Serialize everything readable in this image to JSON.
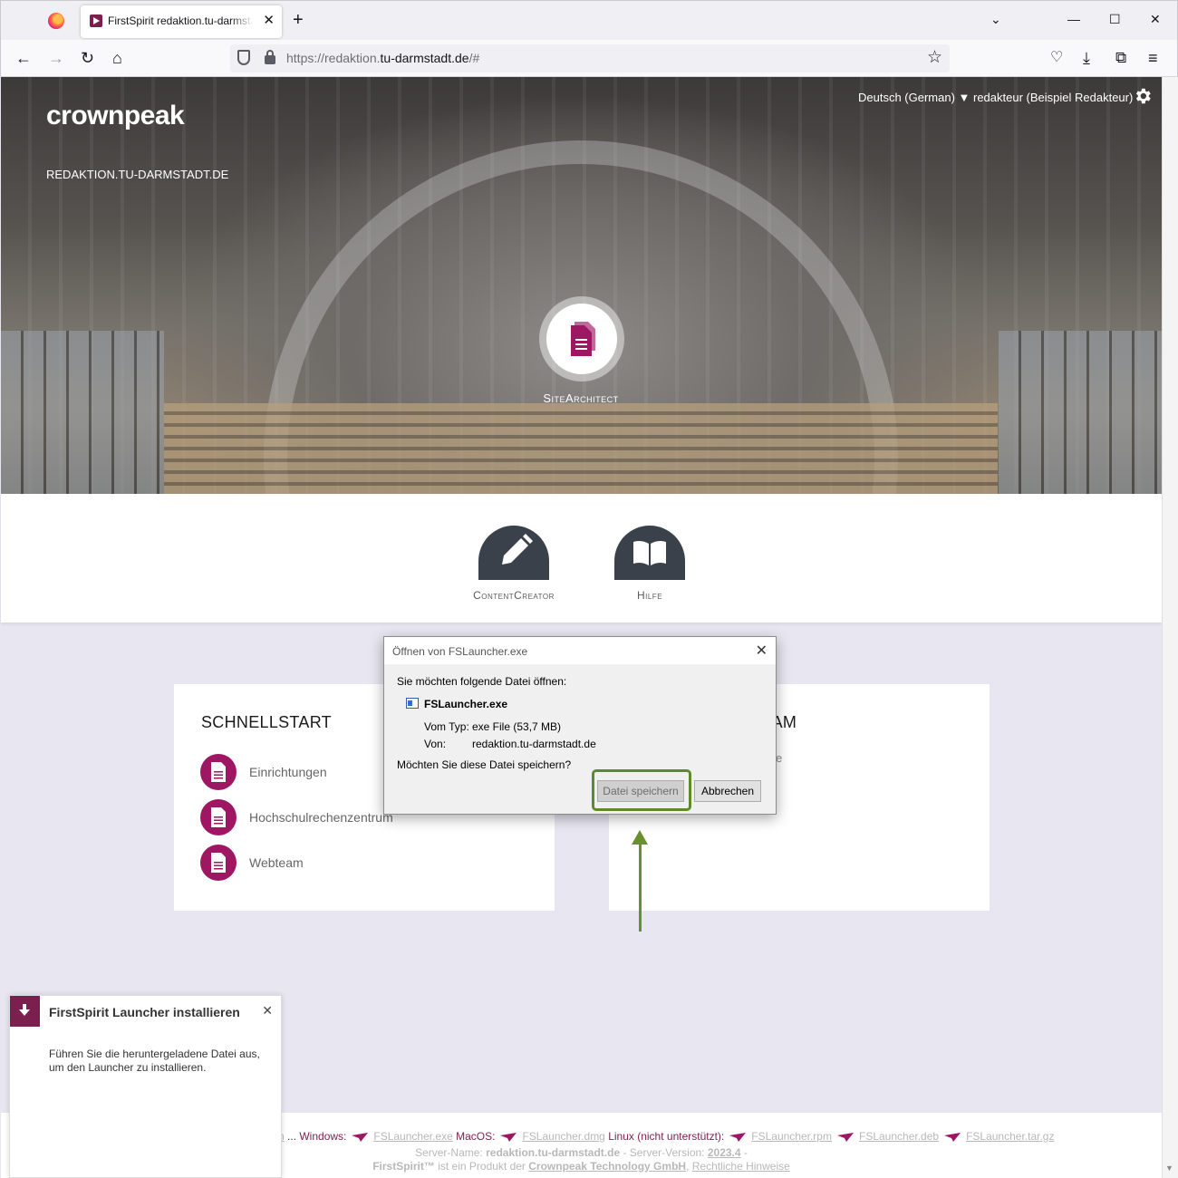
{
  "browser": {
    "tab_title": "FirstSpirit redaktion.tu-darmstadt.de",
    "tab_close": "✕",
    "new_tab": "+",
    "list_tabs": "⌄",
    "minimize": "—",
    "maximize": "☐",
    "close": "✕",
    "url_prefix": "https://redaktion.",
    "url_domain": "tu-darmstadt.de",
    "url_suffix": "/#"
  },
  "header": {
    "logo": "crownpeak",
    "server_name": "REDAKTION.TU-DARMSTADT.DE",
    "language": "Deutsch (German) ▼",
    "user": "redakteur (Beispiel Redakteur)"
  },
  "apps": {
    "site_architect": "SiteArchitect",
    "content_creator": "ContentCreator",
    "help": "Hilfe"
  },
  "quickstart": {
    "title": "SCHNELLSTART",
    "items": [
      {
        "label": "Einrichtungen"
      },
      {
        "label": "Hochschulrechenzentrum"
      },
      {
        "label": "Webteam"
      }
    ]
  },
  "right_card": {
    "title_visible": "TEAM",
    "text_visible": "e"
  },
  "dialog": {
    "title": "Öffnen von FSLauncher.exe",
    "close": "✕",
    "prompt": "Sie möchten folgende Datei öffnen:",
    "filename": "FSLauncher.exe",
    "type_label": "Vom Typ:",
    "type_value": "exe File (53,7 MB)",
    "from_label": "Von:",
    "from_value": "redaktion.tu-darmstadt.de",
    "question": "Möchten Sie diese Datei speichern?",
    "save_button": "Datei speichern",
    "cancel_button": "Abbrechen"
  },
  "footer": {
    "line1_lead": "n",
    "line1_dots": " ... ",
    "windows_label": "Windows:",
    "windows_file": "FSLauncher.exe",
    "macos_label": "MacOS:",
    "macos_file": "FSLauncher.dmg",
    "linux_label": "Linux (nicht unterstützt):",
    "linux_rpm": "FSLauncher.rpm",
    "linux_deb": "FSLauncher.deb",
    "linux_tar": "FSLauncher.tar.gz",
    "server_label": "Server-Name:",
    "server_value": "redaktion.tu-darmstadt.de",
    "version_label": " - Server-Version:",
    "version_value": "2023.4",
    "version_tail": " -",
    "product_name": "FirstSpirit™",
    "product_text": " ist ein Produkt der ",
    "company": "Crownpeak Technology GmbH",
    "legal": "Rechtliche Hinweise"
  },
  "notification": {
    "title": "FirstSpirit Launcher installieren",
    "close": "✕",
    "body": "Führen Sie die heruntergeladene Datei aus, um den Launcher zu installieren."
  },
  "colors": {
    "accent": "#9e1763",
    "brand_dark": "#7b1f4f",
    "highlight": "#5f8a2c",
    "app_circle": "#3b414b",
    "page_bg": "#e8e6f0"
  }
}
